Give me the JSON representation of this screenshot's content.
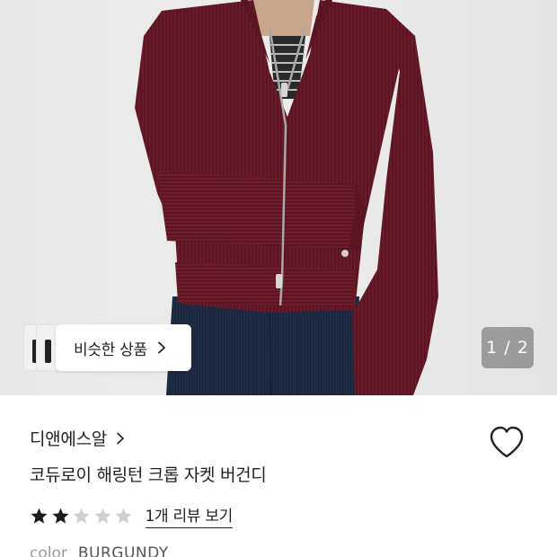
{
  "gallery": {
    "similar_button_label": "비슷한 상품",
    "page_indicator": "1 / 2"
  },
  "product": {
    "brand": "디앤에스알",
    "name": "코듀로이 해링턴 크롭 자켓 버건디",
    "rating": 2,
    "rating_max": 5,
    "review_link_label": "1개 리뷰 보기",
    "color_label": "color",
    "color_value": "BURGUNDY"
  },
  "colors": {
    "jacket": "#6b1a2a",
    "star_filled": "#1a1a1a",
    "star_empty": "#cfcfcf"
  },
  "icons": {
    "wishlist": "heart-outline-icon",
    "brand_link": "chevron-right-icon",
    "similar": "chevron-right-icon"
  }
}
